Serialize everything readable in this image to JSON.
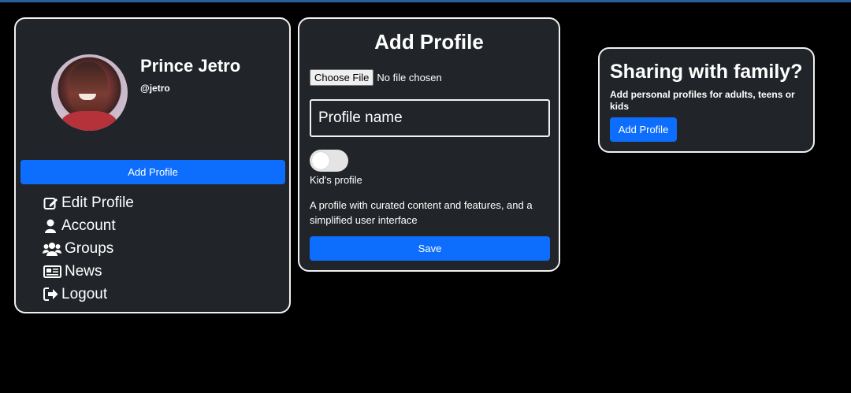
{
  "profile": {
    "name": "Prince Jetro",
    "handle": "@jetro",
    "add_button": "Add Profile",
    "menu": [
      {
        "label": "Edit Profile",
        "icon": "edit-icon"
      },
      {
        "label": "Account",
        "icon": "user-icon"
      },
      {
        "label": "Groups",
        "icon": "users-icon"
      },
      {
        "label": "News",
        "icon": "newspaper-icon"
      },
      {
        "label": "Logout",
        "icon": "sign-out-icon"
      }
    ]
  },
  "add_profile": {
    "title": "Add Profile",
    "choose_file": "Choose File",
    "file_status": "No file chosen",
    "name_placeholder": "Profile name",
    "name_value": "",
    "kids_toggle_on": false,
    "kids_label": "Kid's profile",
    "kids_description": "A profile with curated content and features, and a simplified user interface",
    "save_button": "Save"
  },
  "sharing": {
    "title": "Sharing with family?",
    "description": "Add personal profiles for adults, teens or kids",
    "button": "Add Profile"
  },
  "colors": {
    "background": "#000000",
    "card": "#212529",
    "primary": "#0d6efd",
    "border": "#f1f1f1"
  }
}
